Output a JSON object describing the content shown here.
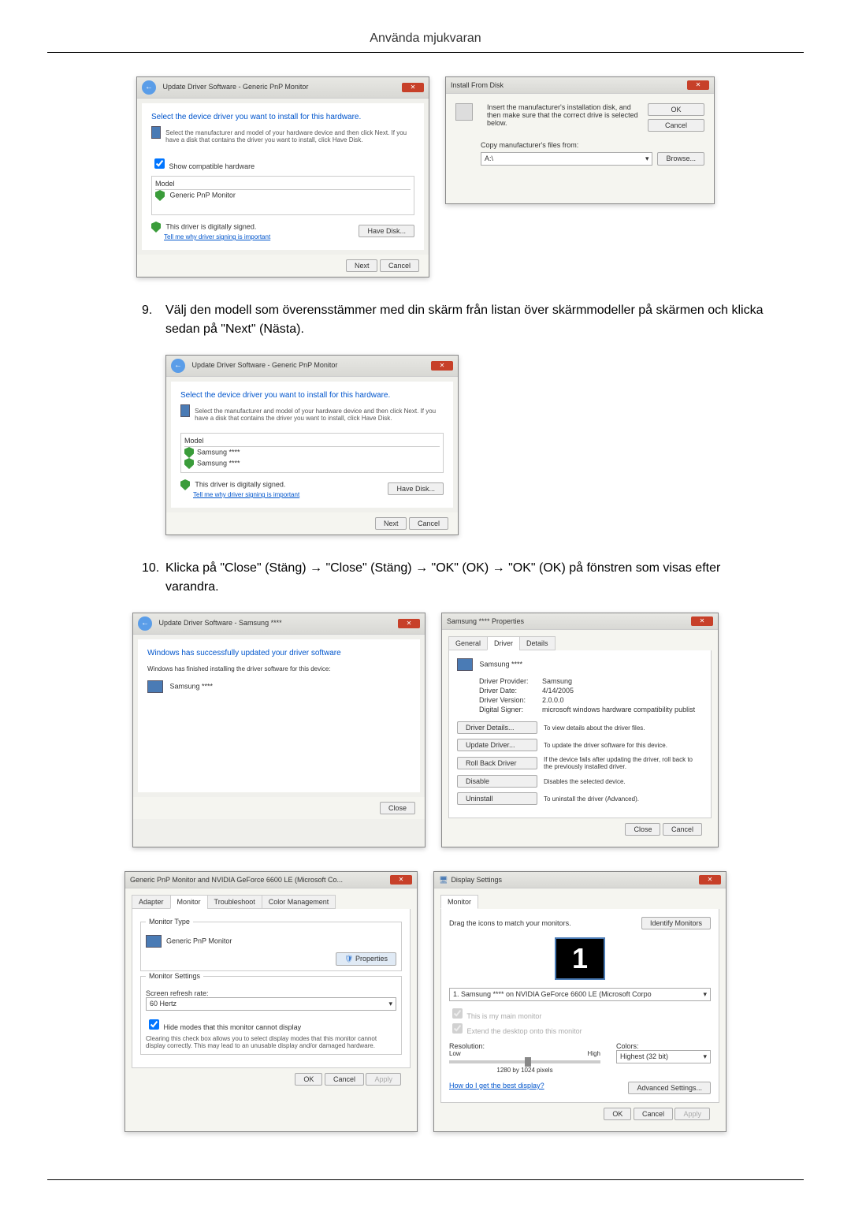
{
  "header": {
    "title": "Använda mjukvaran"
  },
  "steps": {
    "s9": {
      "num": "9.",
      "text": "Välj den modell som överensstämmer med din skärm från listan över skärmmodeller på skärmen och klicka sedan på \"Next\" (Nästa)."
    },
    "s10": {
      "num": "10.",
      "text": "Klicka på \"Close\" (Stäng) → \"Close\" (Stäng) → \"OK\" (OK) → \"OK\" (OK) på fönstren som visas efter varandra."
    }
  },
  "dlg_update1": {
    "breadcrumb": "Update Driver Software - Generic PnP Monitor",
    "heading": "Select the device driver you want to install for this hardware.",
    "instruction": "Select the manufacturer and model of your hardware device and then click Next. If you have a disk that contains the driver you want to install, click Have Disk.",
    "show_compat": "Show compatible hardware",
    "model_label": "Model",
    "model_item": "Generic PnP Monitor",
    "signed": "This driver is digitally signed.",
    "tell_me": "Tell me why driver signing is important",
    "have_disk": "Have Disk...",
    "next": "Next",
    "cancel": "Cancel"
  },
  "dlg_install_disk": {
    "title": "Install From Disk",
    "instruction": "Insert the manufacturer's installation disk, and then make sure that the correct drive is selected below.",
    "ok": "OK",
    "cancel": "Cancel",
    "copy_from": "Copy manufacturer's files from:",
    "drive": "A:\\",
    "browse": "Browse..."
  },
  "dlg_update2": {
    "breadcrumb": "Update Driver Software - Generic PnP Monitor",
    "heading": "Select the device driver you want to install for this hardware.",
    "instruction": "Select the manufacturer and model of your hardware device and then click Next. If you have a disk that contains the driver you want to install, click Have Disk.",
    "model_label": "Model",
    "model_item1": "Samsung ****",
    "model_item2": "Samsung ****",
    "signed": "This driver is digitally signed.",
    "tell_me": "Tell me why driver signing is important",
    "have_disk": "Have Disk...",
    "next": "Next",
    "cancel": "Cancel"
  },
  "dlg_success": {
    "breadcrumb": "Update Driver Software - Samsung ****",
    "heading": "Windows has successfully updated your driver software",
    "sub": "Windows has finished installing the driver software for this device:",
    "device": "Samsung ****",
    "close": "Close"
  },
  "dlg_props": {
    "title": "Samsung **** Properties",
    "tab_general": "General",
    "tab_driver": "Driver",
    "tab_details": "Details",
    "device": "Samsung ****",
    "provider_l": "Driver Provider:",
    "provider_v": "Samsung",
    "date_l": "Driver Date:",
    "date_v": "4/14/2005",
    "version_l": "Driver Version:",
    "version_v": "2.0.0.0",
    "signer_l": "Digital Signer:",
    "signer_v": "microsoft windows hardware compatibility publist",
    "btn_details": "Driver Details...",
    "desc_details": "To view details about the driver files.",
    "btn_update": "Update Driver...",
    "desc_update": "To update the driver software for this device.",
    "btn_rollback": "Roll Back Driver",
    "desc_rollback": "If the device fails after updating the driver, roll back to the previously installed driver.",
    "btn_disable": "Disable",
    "desc_disable": "Disables the selected device.",
    "btn_uninstall": "Uninstall",
    "desc_uninstall": "To uninstall the driver (Advanced).",
    "close": "Close",
    "cancel": "Cancel"
  },
  "dlg_monitor": {
    "title": "Generic PnP Monitor and NVIDIA GeForce 6600 LE (Microsoft Co...",
    "tab_adapter": "Adapter",
    "tab_monitor": "Monitor",
    "tab_trouble": "Troubleshoot",
    "tab_color": "Color Management",
    "type_label": "Monitor Type",
    "type_val": "Generic PnP Monitor",
    "btn_props": "Properties",
    "settings_label": "Monitor Settings",
    "refresh_label": "Screen refresh rate:",
    "refresh_val": "60 Hertz",
    "hide_modes": "Hide modes that this monitor cannot display",
    "hide_desc": "Clearing this check box allows you to select display modes that this monitor cannot display correctly. This may lead to an unusable display and/or damaged hardware.",
    "ok": "OK",
    "cancel": "Cancel",
    "apply": "Apply"
  },
  "dlg_display": {
    "title": "Display Settings",
    "tab_monitor": "Monitor",
    "drag_text": "Drag the icons to match your monitors.",
    "identify": "Identify Monitors",
    "monitor_num": "1",
    "monitor_sel": "1. Samsung **** on NVIDIA GeForce 6600 LE (Microsoft Corpo",
    "this_main": "This is my main monitor",
    "extend": "Extend the desktop onto this monitor",
    "res_label": "Resolution:",
    "low": "Low",
    "high": "High",
    "res_val": "1280 by 1024 pixels",
    "colors_label": "Colors:",
    "colors_val": "Highest (32 bit)",
    "help_link": "How do I get the best display?",
    "advanced": "Advanced Settings...",
    "ok": "OK",
    "cancel": "Cancel",
    "apply": "Apply"
  }
}
